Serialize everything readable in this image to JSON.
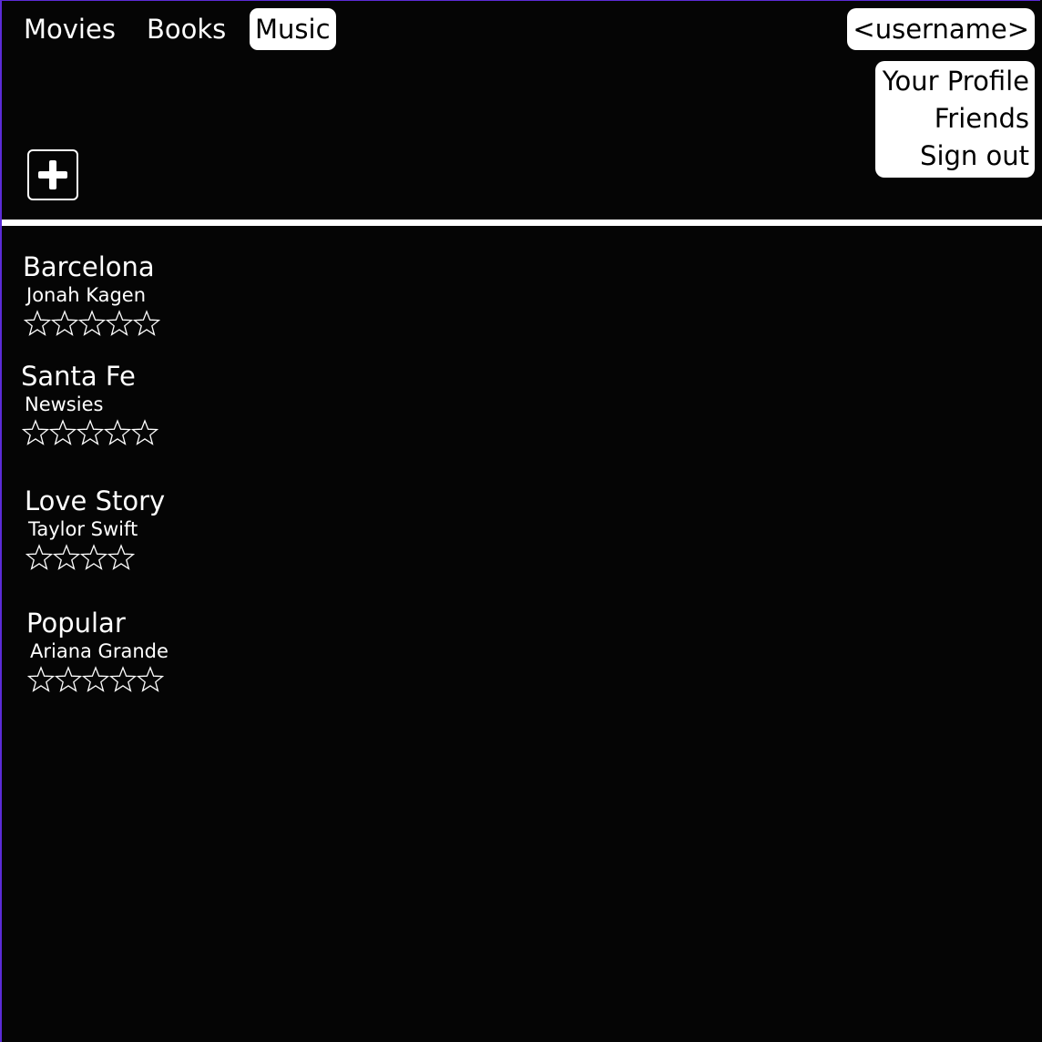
{
  "nav": {
    "tabs": [
      {
        "label": "Movies",
        "active": false
      },
      {
        "label": "Books",
        "active": false
      },
      {
        "label": "Music",
        "active": true
      }
    ]
  },
  "user": {
    "button_label": "<username>",
    "menu": [
      "Your Profile",
      "Friends",
      "Sign out"
    ]
  },
  "toolbar": {
    "add_icon": "plus-icon"
  },
  "songs": [
    {
      "title": "Barcelona",
      "artist": "Jonah Kagen",
      "stars": 5,
      "rating": 0
    },
    {
      "title": "Santa Fe",
      "artist": "Newsies",
      "stars": 5,
      "rating": 0
    },
    {
      "title": "Love Story",
      "artist": "Taylor Swift",
      "stars": 4,
      "rating": 0
    },
    {
      "title": "Popular",
      "artist": "Ariana Grande",
      "stars": 5,
      "rating": 0
    }
  ],
  "colors": {
    "background": "#050505",
    "foreground": "#ffffff",
    "accent_border": "#5b2bd6"
  }
}
